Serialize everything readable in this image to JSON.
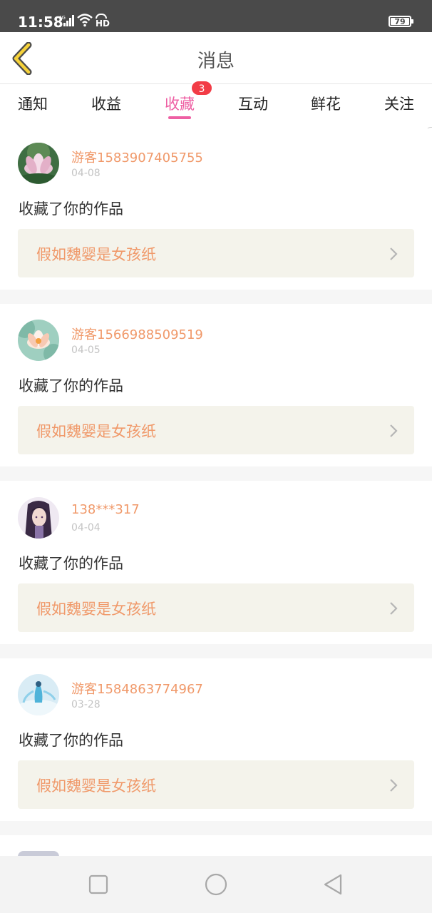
{
  "status_bar": {
    "time": "11:58",
    "network": "4G",
    "hd": "HD",
    "battery": "79"
  },
  "header": {
    "title": "消息",
    "back_icon": "chevron-left-icon"
  },
  "tabs": [
    {
      "label": "通知",
      "active": false
    },
    {
      "label": "收益",
      "active": false
    },
    {
      "label": "收藏",
      "active": true,
      "badge": "3"
    },
    {
      "label": "互动",
      "active": false
    },
    {
      "label": "鲜花",
      "active": false
    },
    {
      "label": "关注",
      "active": false
    }
  ],
  "messages": [
    {
      "username": "游客1583907405755",
      "date": "04-08",
      "action": "收藏了你的作品",
      "work_title": "假如魏婴是女孩纸",
      "avatar": "lotus-avatar"
    },
    {
      "username": "游客1566988509519",
      "date": "04-05",
      "action": "收藏了你的作品",
      "work_title": "假如魏婴是女孩纸",
      "avatar": "water-lily-avatar"
    },
    {
      "username": "138***317",
      "date": "04-04",
      "action": "收藏了你的作品",
      "work_title": "假如魏婴是女孩纸",
      "avatar": "anime-character-avatar"
    },
    {
      "username": "游客1584863774967",
      "date": "03-28",
      "action": "收藏了你的作品",
      "work_title": "假如魏婴是女孩纸",
      "avatar": "blue-fairy-avatar"
    }
  ],
  "nav_bar": {
    "icons": [
      "square-icon",
      "circle-icon",
      "triangle-back-icon"
    ]
  },
  "colors": {
    "accent": "#ee5fa3",
    "username": "#f0996a",
    "badge": "#f23c46",
    "work_bg": "#f4f3eb"
  }
}
